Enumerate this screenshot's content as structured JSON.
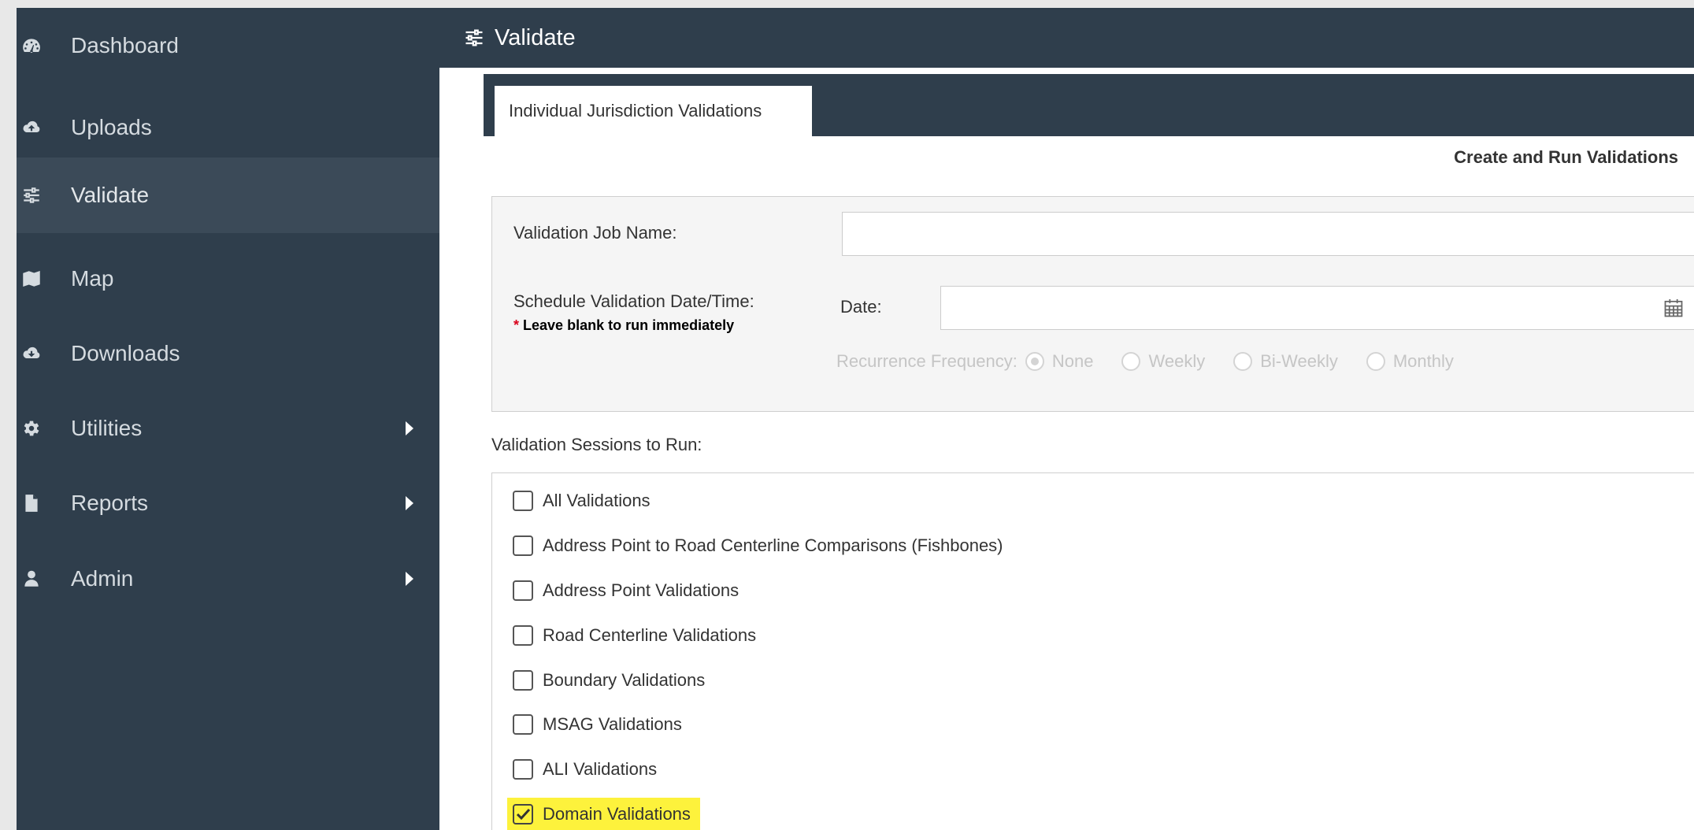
{
  "sidebar": {
    "items": [
      {
        "label": "Dashboard",
        "icon": "dashboard-icon"
      },
      {
        "label": "Uploads",
        "icon": "cloud-upload-icon"
      },
      {
        "label": "Validate",
        "icon": "sliders-icon",
        "active": true
      },
      {
        "label": "Map",
        "icon": "map-icon"
      },
      {
        "label": "Downloads",
        "icon": "cloud-download-icon"
      },
      {
        "label": "Utilities",
        "icon": "gear-icon",
        "submenu": true
      },
      {
        "label": "Reports",
        "icon": "file-icon",
        "submenu": true
      },
      {
        "label": "Admin",
        "icon": "user-icon",
        "submenu": true
      }
    ]
  },
  "header": {
    "title": "Validate",
    "icon": "sliders-icon"
  },
  "tabs": [
    {
      "label": "Individual Jurisdiction Validations",
      "active": true
    }
  ],
  "section_title": "Create and Run Validations",
  "form": {
    "job_name_label": "Validation Job Name:",
    "job_name_value": "",
    "schedule_label": "Schedule Validation Date/Time:",
    "schedule_note_star": "*",
    "schedule_note": "Leave blank to run immediately",
    "date_label": "Date:",
    "date_value": "",
    "recurrence_label": "Recurrence Frequency:",
    "recurrence_options": [
      {
        "label": "None",
        "selected": true
      },
      {
        "label": "Weekly",
        "selected": false
      },
      {
        "label": "Bi-Weekly",
        "selected": false
      },
      {
        "label": "Monthly",
        "selected": false
      }
    ]
  },
  "sessions": {
    "label": "Validation Sessions to Run:",
    "items": [
      {
        "label": "All Validations",
        "checked": false
      },
      {
        "label": "Address Point to Road Centerline Comparisons (Fishbones)",
        "checked": false
      },
      {
        "label": "Address Point Validations",
        "checked": false
      },
      {
        "label": "Road Centerline Validations",
        "checked": false
      },
      {
        "label": "Boundary Validations",
        "checked": false
      },
      {
        "label": "MSAG Validations",
        "checked": false
      },
      {
        "label": "ALI Validations",
        "checked": false
      },
      {
        "label": "Domain Validations",
        "checked": true
      }
    ]
  },
  "colors": {
    "sidebar_bg": "#2f3e4c",
    "active_item_bg": "#3b4a58",
    "highlight": "#fdf23c",
    "required_star": "#d9001b"
  }
}
